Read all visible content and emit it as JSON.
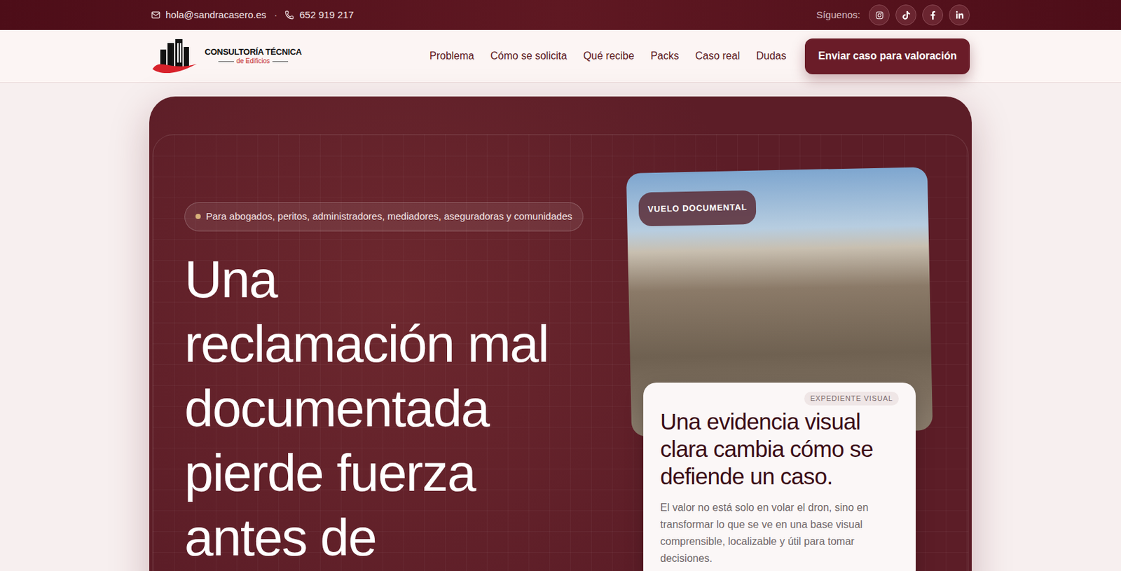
{
  "topbar": {
    "email": "hola@sandracasero.es",
    "separator": "·",
    "phone": "652 919 217",
    "follow_label": "Síguenos:"
  },
  "nav": {
    "logo_title": "CONSULTORÍA TÉCNICA",
    "logo_subtitle": "de Edificios",
    "links": [
      {
        "label": "Problema",
        "selected": false
      },
      {
        "label": "Cómo se solicita",
        "selected": false
      },
      {
        "label": "Qué recibe",
        "selected": false
      },
      {
        "label": "Packs",
        "selected": false
      },
      {
        "label": "Caso real",
        "selected": false
      },
      {
        "label": "Dudas",
        "selected": false
      }
    ],
    "cta": "Enviar caso para valoración"
  },
  "hero": {
    "badge": "Para abogados, peritos, administradores, mediadores, aseguradoras y comunidades",
    "heading_lines": [
      "Una",
      "reclamación mal",
      "documentada",
      "pierde fuerza",
      "antes de"
    ],
    "photo_badge": "VUELO DOCUMENTAL",
    "card": {
      "label": "EXPEDIENTE VISUAL",
      "title": "Una evidencia visual clara cambia cómo se defiende un caso.",
      "text": "El valor no está solo en volar el dron, sino en transformar lo que se ve en una base visual comprensible, localizable y útil para tomar decisiones."
    }
  }
}
